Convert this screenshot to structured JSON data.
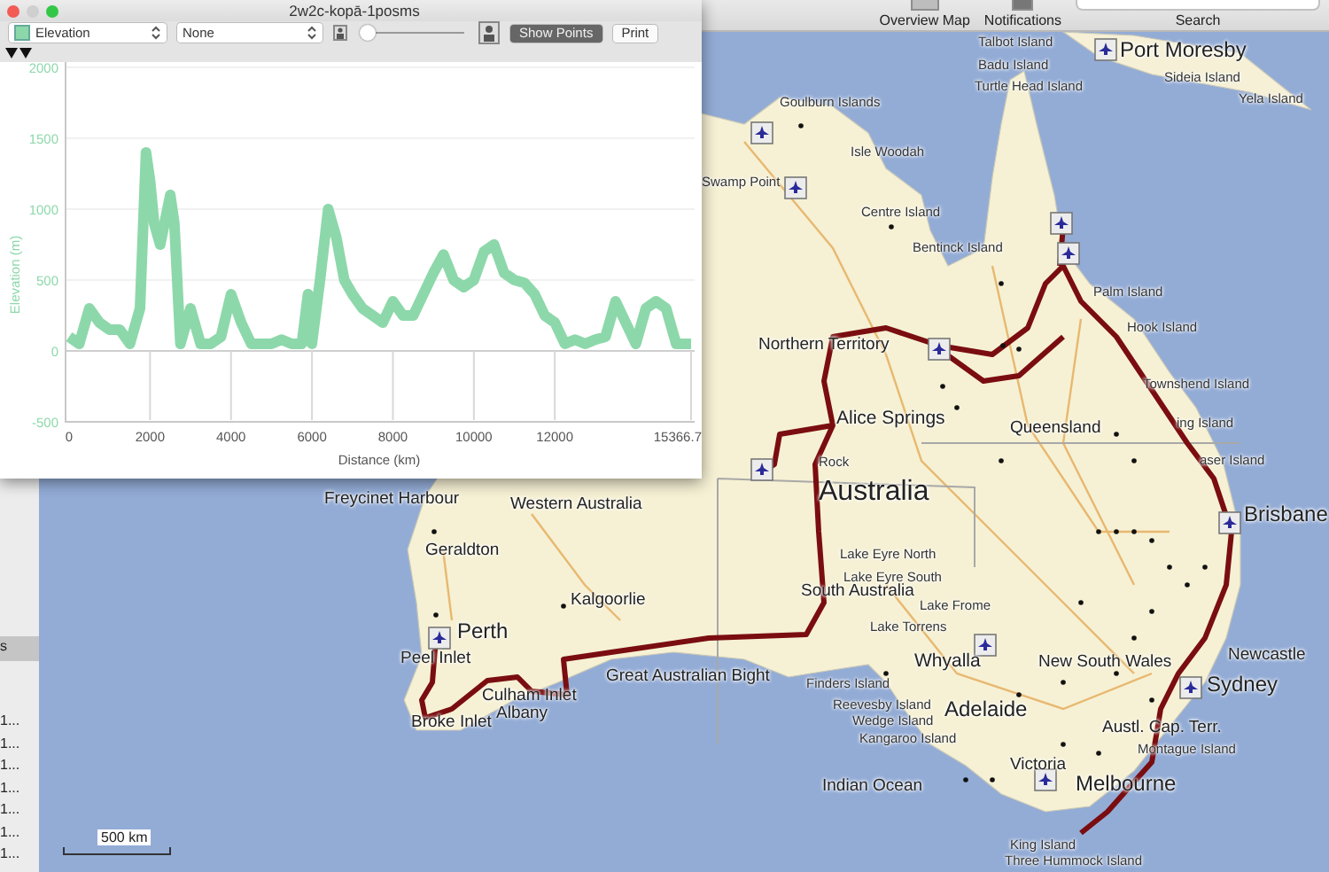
{
  "window": {
    "title": "2w2c-kopā-1posms"
  },
  "profile_toolbar": {
    "compare_select": {
      "value": "None"
    },
    "zoom_slider": {
      "level": 0.05
    },
    "show_points": {
      "label": "Show Points",
      "on": true
    },
    "print": {
      "label": "Print"
    }
  },
  "elevation_profile": {
    "chart_data": {
      "type": "line",
      "grid": true,
      "xlabel": "Distance (km)",
      "ylabel": "Elevation (m)",
      "xlim": [
        0,
        15366.7
      ],
      "ylim": [
        -500,
        2000
      ],
      "xticks": [
        0,
        2000,
        4000,
        6000,
        8000,
        10000,
        12000,
        {
          "value": 15366.7,
          "label": "15366.7"
        }
      ],
      "yticks": [
        -500,
        0,
        500,
        1000,
        1500,
        2000
      ],
      "x": [
        0,
        250,
        500,
        750,
        1000,
        1250,
        1500,
        1750,
        1900,
        2000,
        2100,
        2250,
        2500,
        2600,
        2750,
        3000,
        3250,
        3500,
        3750,
        4000,
        4250,
        4500,
        5000,
        5250,
        5500,
        5750,
        5900,
        6000,
        6200,
        6400,
        6600,
        6800,
        7000,
        7250,
        7500,
        7750,
        8000,
        8250,
        8500,
        8750,
        9000,
        9250,
        9500,
        9750,
        10000,
        10250,
        10500,
        10750,
        11000,
        11250,
        11500,
        11750,
        12000,
        12250,
        12500,
        12750,
        13000,
        13250,
        13500,
        13750,
        14000,
        14250,
        14500,
        14750,
        15000,
        15366.7
      ],
      "series": [
        {
          "name": "Elevation",
          "color": "#8dd8aa",
          "values": [
            100,
            50,
            300,
            200,
            150,
            150,
            50,
            300,
            1400,
            1200,
            900,
            750,
            1100,
            900,
            50,
            300,
            50,
            50,
            100,
            400,
            200,
            50,
            50,
            80,
            50,
            50,
            400,
            50,
            500,
            1000,
            800,
            500,
            400,
            300,
            250,
            200,
            350,
            250,
            250,
            400,
            550,
            680,
            500,
            450,
            500,
            700,
            750,
            550,
            500,
            480,
            400,
            250,
            200,
            50,
            80,
            50,
            80,
            100,
            350,
            200,
            50,
            300,
            350,
            300,
            50,
            50
          ]
        }
      ]
    }
  },
  "app_toolbar": {
    "items": [
      {
        "label": "Overview Map"
      },
      {
        "label": "Notifications"
      }
    ],
    "search": {
      "label": "Search"
    }
  },
  "sidebar": {
    "items": [
      {
        "text": "s",
        "selected": true
      },
      {
        "text": "1...",
        "selected": false
      },
      {
        "text": "1...",
        "selected": false
      },
      {
        "text": "1...",
        "selected": false
      },
      {
        "text": "1...",
        "selected": false
      },
      {
        "text": "1...",
        "selected": false
      },
      {
        "text": "1...",
        "selected": false
      },
      {
        "text": "1...",
        "selected": false
      }
    ]
  },
  "map": {
    "labels": [
      {
        "text": "Talbot Island",
        "kind": "island"
      },
      {
        "text": "Badu Island",
        "kind": "island"
      },
      {
        "text": "Turtle Head Island",
        "kind": "island"
      },
      {
        "text": "Port Moresby",
        "kind": "city"
      },
      {
        "text": "Sideia Island",
        "kind": "island"
      },
      {
        "text": "Yela Island",
        "kind": "island"
      },
      {
        "text": "Goulburn Islands",
        "kind": "island"
      },
      {
        "text": "Isle Woodah",
        "kind": "island"
      },
      {
        "text": "Swamp Point",
        "kind": "island"
      },
      {
        "text": "Centre Island",
        "kind": "island"
      },
      {
        "text": "Bentinck Island",
        "kind": "island"
      },
      {
        "text": "Palm Island",
        "kind": "island"
      },
      {
        "text": "Hook Island",
        "kind": "island"
      },
      {
        "text": "Townshend Island",
        "kind": "island"
      },
      {
        "text": "ing Island",
        "kind": "island"
      },
      {
        "text": "aser Island",
        "kind": "island"
      },
      {
        "text": "Northern Territory",
        "kind": "region"
      },
      {
        "text": "Alice Springs",
        "kind": "town"
      },
      {
        "text": "Rock",
        "kind": "island"
      },
      {
        "text": "Queensland",
        "kind": "region"
      },
      {
        "text": "Australia",
        "kind": "country"
      },
      {
        "text": "Brisbane",
        "kind": "city"
      },
      {
        "text": "Freycinet Harbour",
        "kind": "region"
      },
      {
        "text": "Western Australia",
        "kind": "region"
      },
      {
        "text": "Geraldton",
        "kind": "region"
      },
      {
        "text": "Kalgoorlie",
        "kind": "region"
      },
      {
        "text": "Perth",
        "kind": "city"
      },
      {
        "text": "Peel Inlet",
        "kind": "region"
      },
      {
        "text": "Culham Inlet",
        "kind": "region"
      },
      {
        "text": "Albany",
        "kind": "region"
      },
      {
        "text": "Broke Inlet",
        "kind": "region"
      },
      {
        "text": "Great Australian Bight",
        "kind": "region"
      },
      {
        "text": "Lake Eyre North",
        "kind": "island"
      },
      {
        "text": "Lake Eyre South",
        "kind": "island"
      },
      {
        "text": "South Australia",
        "kind": "region"
      },
      {
        "text": "Lake Frome",
        "kind": "island"
      },
      {
        "text": "Lake Torrens",
        "kind": "island"
      },
      {
        "text": "Whyalla",
        "kind": "town"
      },
      {
        "text": "Finders Island",
        "kind": "island"
      },
      {
        "text": "Reevesby Island",
        "kind": "island"
      },
      {
        "text": "Wedge Island",
        "kind": "island"
      },
      {
        "text": "Adelaide",
        "kind": "city"
      },
      {
        "text": "Kangaroo Island",
        "kind": "island"
      },
      {
        "text": "New South Wales",
        "kind": "region"
      },
      {
        "text": "Newcastle",
        "kind": "region"
      },
      {
        "text": "Sydney",
        "kind": "city"
      },
      {
        "text": "Austl. Cap. Terr.",
        "kind": "region"
      },
      {
        "text": "Montague Island",
        "kind": "island"
      },
      {
        "text": "Victoria",
        "kind": "region"
      },
      {
        "text": "Indian Ocean",
        "kind": "region"
      },
      {
        "text": "Melbourne",
        "kind": "city"
      },
      {
        "text": "King Island",
        "kind": "island"
      },
      {
        "text": "Three Hummock Island",
        "kind": "island"
      }
    ],
    "scale": "500 km"
  }
}
